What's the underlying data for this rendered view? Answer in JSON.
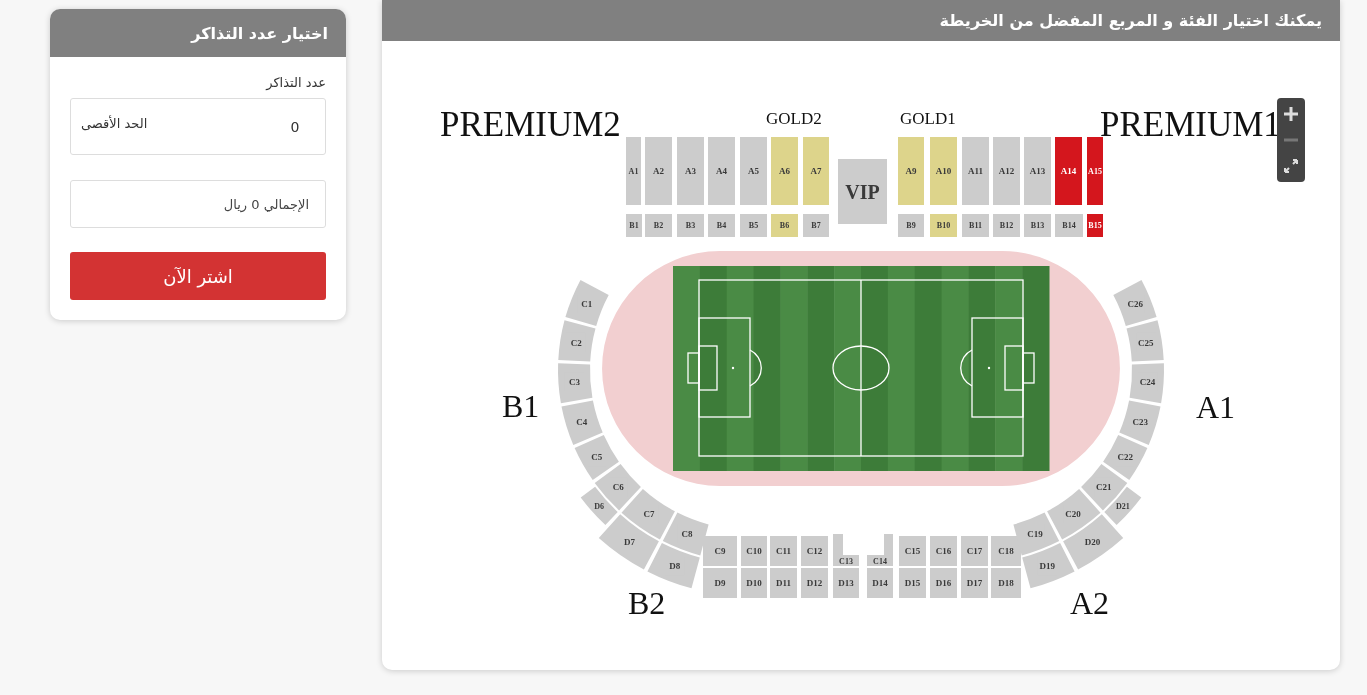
{
  "ticket_panel": {
    "title": "اختيار عدد التذاكر",
    "count_label": "عدد التذاكر",
    "count_field": {
      "value": "0",
      "hint": "الحد الأقصى"
    },
    "total": "الإجمالي 0 ريال",
    "buy_button": "اشتر الآن"
  },
  "map": {
    "instruction": "يمكنك اختيار الفئة و المربع المفضل من الخريطة",
    "zone_labels": [
      {
        "text": "PREMIUM2"
      },
      {
        "text": "GOLD2"
      },
      {
        "text": "GOLD1"
      },
      {
        "text": "PREMIUM1"
      },
      {
        "text": "B1"
      },
      {
        "text": "A1"
      },
      {
        "text": "B2"
      },
      {
        "text": "A2"
      }
    ],
    "sections": [
      {
        "label": "A1",
        "color": "#cccccc"
      },
      {
        "label": "A2",
        "color": "#cccccc"
      },
      {
        "label": "A3",
        "color": "#cccccc"
      },
      {
        "label": "A4",
        "color": "#cccccc"
      },
      {
        "label": "A5",
        "color": "#cccccc"
      },
      {
        "label": "A6",
        "color": "#ddd48b"
      },
      {
        "label": "A7",
        "color": "#ddd48b"
      },
      {
        "label": "VIP",
        "color": "#cccccc"
      },
      {
        "label": "A9",
        "color": "#ddd48b"
      },
      {
        "label": "A10",
        "color": "#ddd48b"
      },
      {
        "label": "A11",
        "color": "#cccccc"
      },
      {
        "label": "A12",
        "color": "#cccccc"
      },
      {
        "label": "A13",
        "color": "#cccccc"
      },
      {
        "label": "A14",
        "color": "#d4161d"
      },
      {
        "label": "A15",
        "color": "#d4161d"
      },
      {
        "label": "B1",
        "color": "#cccccc"
      },
      {
        "label": "B2",
        "color": "#cccccc"
      },
      {
        "label": "B3",
        "color": "#cccccc"
      },
      {
        "label": "B4",
        "color": "#cccccc"
      },
      {
        "label": "B5",
        "color": "#cccccc"
      },
      {
        "label": "B6",
        "color": "#ddd48b"
      },
      {
        "label": "B7",
        "color": "#cccccc"
      },
      {
        "label": "B9",
        "color": "#cccccc"
      },
      {
        "label": "B10",
        "color": "#ddd48b"
      },
      {
        "label": "B11",
        "color": "#cccccc"
      },
      {
        "label": "B12",
        "color": "#cccccc"
      },
      {
        "label": "B13",
        "color": "#cccccc"
      },
      {
        "label": "B14",
        "color": "#cccccc"
      },
      {
        "label": "B15",
        "color": "#d4161d"
      },
      {
        "label": "C1",
        "color": "#cccccc"
      },
      {
        "label": "C2",
        "color": "#cccccc"
      },
      {
        "label": "C3",
        "color": "#cccccc"
      },
      {
        "label": "C4",
        "color": "#cccccc"
      },
      {
        "label": "C5",
        "color": "#cccccc"
      },
      {
        "label": "C6",
        "color": "#cccccc"
      },
      {
        "label": "C7",
        "color": "#cccccc"
      },
      {
        "label": "C8",
        "color": "#cccccc"
      },
      {
        "label": "C9",
        "color": "#cccccc"
      },
      {
        "label": "C10",
        "color": "#cccccc"
      },
      {
        "label": "C11",
        "color": "#cccccc"
      },
      {
        "label": "C12",
        "color": "#cccccc"
      },
      {
        "label": "C13",
        "color": "#cccccc"
      },
      {
        "label": "C14",
        "color": "#cccccc"
      },
      {
        "label": "C15",
        "color": "#cccccc"
      },
      {
        "label": "C16",
        "color": "#cccccc"
      },
      {
        "label": "C17",
        "color": "#cccccc"
      },
      {
        "label": "C18",
        "color": "#cccccc"
      },
      {
        "label": "C19",
        "color": "#cccccc"
      },
      {
        "label": "C20",
        "color": "#cccccc"
      },
      {
        "label": "C21",
        "color": "#cccccc"
      },
      {
        "label": "C22",
        "color": "#cccccc"
      },
      {
        "label": "C23",
        "color": "#cccccc"
      },
      {
        "label": "C24",
        "color": "#cccccc"
      },
      {
        "label": "C25",
        "color": "#cccccc"
      },
      {
        "label": "C26",
        "color": "#cccccc"
      },
      {
        "label": "D6",
        "color": "#cccccc"
      },
      {
        "label": "D7",
        "color": "#cccccc"
      },
      {
        "label": "D8",
        "color": "#cccccc"
      },
      {
        "label": "D9",
        "color": "#cccccc"
      },
      {
        "label": "D10",
        "color": "#cccccc"
      },
      {
        "label": "D11",
        "color": "#cccccc"
      },
      {
        "label": "D12",
        "color": "#cccccc"
      },
      {
        "label": "D13",
        "color": "#cccccc"
      },
      {
        "label": "D14",
        "color": "#cccccc"
      },
      {
        "label": "D15",
        "color": "#cccccc"
      },
      {
        "label": "D16",
        "color": "#cccccc"
      },
      {
        "label": "D17",
        "color": "#cccccc"
      },
      {
        "label": "D18",
        "color": "#cccccc"
      },
      {
        "label": "D19",
        "color": "#cccccc"
      },
      {
        "label": "D20",
        "color": "#cccccc"
      },
      {
        "label": "D21",
        "color": "#cccccc"
      }
    ],
    "zoom_controls": [
      {
        "kind": "zoom-in",
        "disabled": false
      },
      {
        "kind": "zoom-out",
        "disabled": true
      },
      {
        "kind": "fullscreen",
        "disabled": false
      }
    ]
  }
}
